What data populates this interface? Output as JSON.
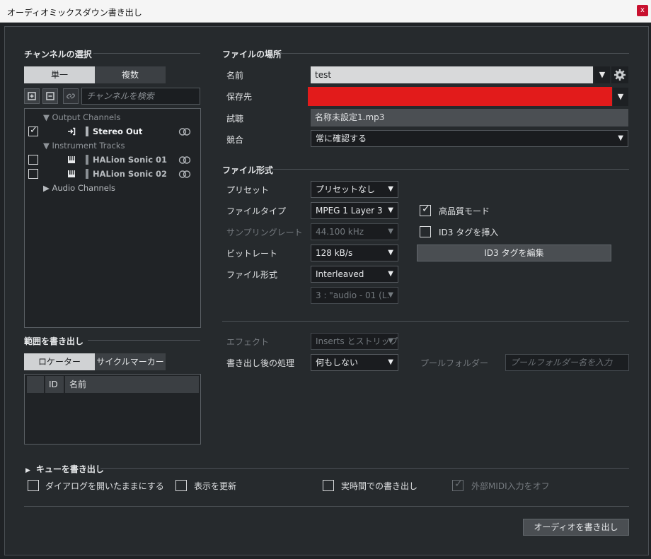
{
  "window": {
    "title": "オーディオミックスダウン書き出し",
    "close_label": "x"
  },
  "channels": {
    "section_title": "チャンネルの選択",
    "tabs": [
      "単一",
      "複数"
    ],
    "search_placeholder": "チャンネルを検索",
    "tree": {
      "output_header": "Output Channels",
      "stereo_out": "Stereo Out",
      "instrument_header": "Instrument Tracks",
      "halion1": "HALion Sonic 01",
      "halion2": "HALion Sonic 02",
      "audio_header": "Audio Channels"
    }
  },
  "range": {
    "section_title": "範囲を書き出し",
    "tabs": [
      "ロケーター",
      "サイクルマーカー"
    ],
    "columns": [
      "ID",
      "名前"
    ]
  },
  "location": {
    "section_title": "ファイルの場所",
    "name_label": "名前",
    "name_value": "test",
    "path_label": "保存先",
    "path_value": "",
    "preview_label": "試聴",
    "preview_value": "名称未設定1.mp3",
    "conflict_label": "競合",
    "conflict_value": "常に確認する"
  },
  "format": {
    "section_title": "ファイル形式",
    "preset_label": "プリセット",
    "preset_value": "プリセットなし",
    "filetype_label": "ファイルタイプ",
    "filetype_value": "MPEG 1 Layer 3",
    "samplerate_label": "サンプリングレート",
    "samplerate_value": "44.100 kHz",
    "bitrate_label": "ビットレート",
    "bitrate_value": "128 kB/s",
    "fileformat_label": "ファイル形式",
    "fileformat_value": "Interleaved",
    "channel_value": "3 : \"audio - 01 (L.",
    "hq_label": "高品質モード",
    "hq_checked": true,
    "id3_label": "ID3 タグを挿入",
    "id3_checked": false,
    "id3_edit_button": "ID3 タグを編集"
  },
  "post": {
    "effect_label": "エフェクト",
    "effect_value": "Inserts とストリップ",
    "after_label": "書き出し後の処理",
    "after_value": "何もしない",
    "pool_label": "プールフォルダー",
    "pool_placeholder": "プールフォルダー名を入力"
  },
  "queue": {
    "title": "キューを書き出し"
  },
  "options": {
    "keep_open": "ダイアログを開いたままにする",
    "update_display": "表示を更新",
    "realtime": "実時間での書き出し",
    "ext_midi_off": "外部MIDI入力をオフ"
  },
  "export_button": "オーディオを書き出し"
}
